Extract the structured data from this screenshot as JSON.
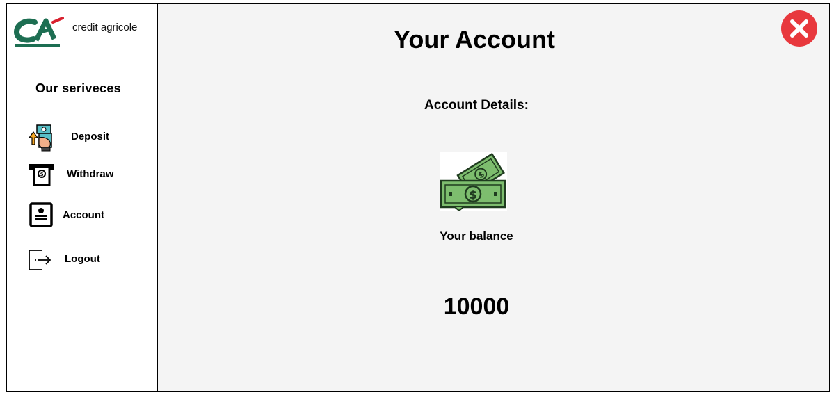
{
  "brand": {
    "name": "credit agricole"
  },
  "sidebar": {
    "title": "Our seriveces",
    "items": [
      {
        "label": "Deposit",
        "icon": "deposit-icon"
      },
      {
        "label": "Withdraw",
        "icon": "atm-withdraw-icon"
      },
      {
        "label": "Account",
        "icon": "account-card-icon"
      },
      {
        "label": "Logout",
        "icon": "logout-icon"
      }
    ]
  },
  "main": {
    "title": "Your Account",
    "details_label": "Account Details:",
    "balance_label": "Your balance",
    "balance_value": "10000",
    "money_icon": "money-icon",
    "close_icon": "close-icon"
  },
  "colors": {
    "main_bg": "#f4f4f4",
    "close_red": "#e8383d",
    "logo_green": "#1d6e52",
    "logo_red": "#d8202e",
    "money_green": "#7dbd6e"
  }
}
